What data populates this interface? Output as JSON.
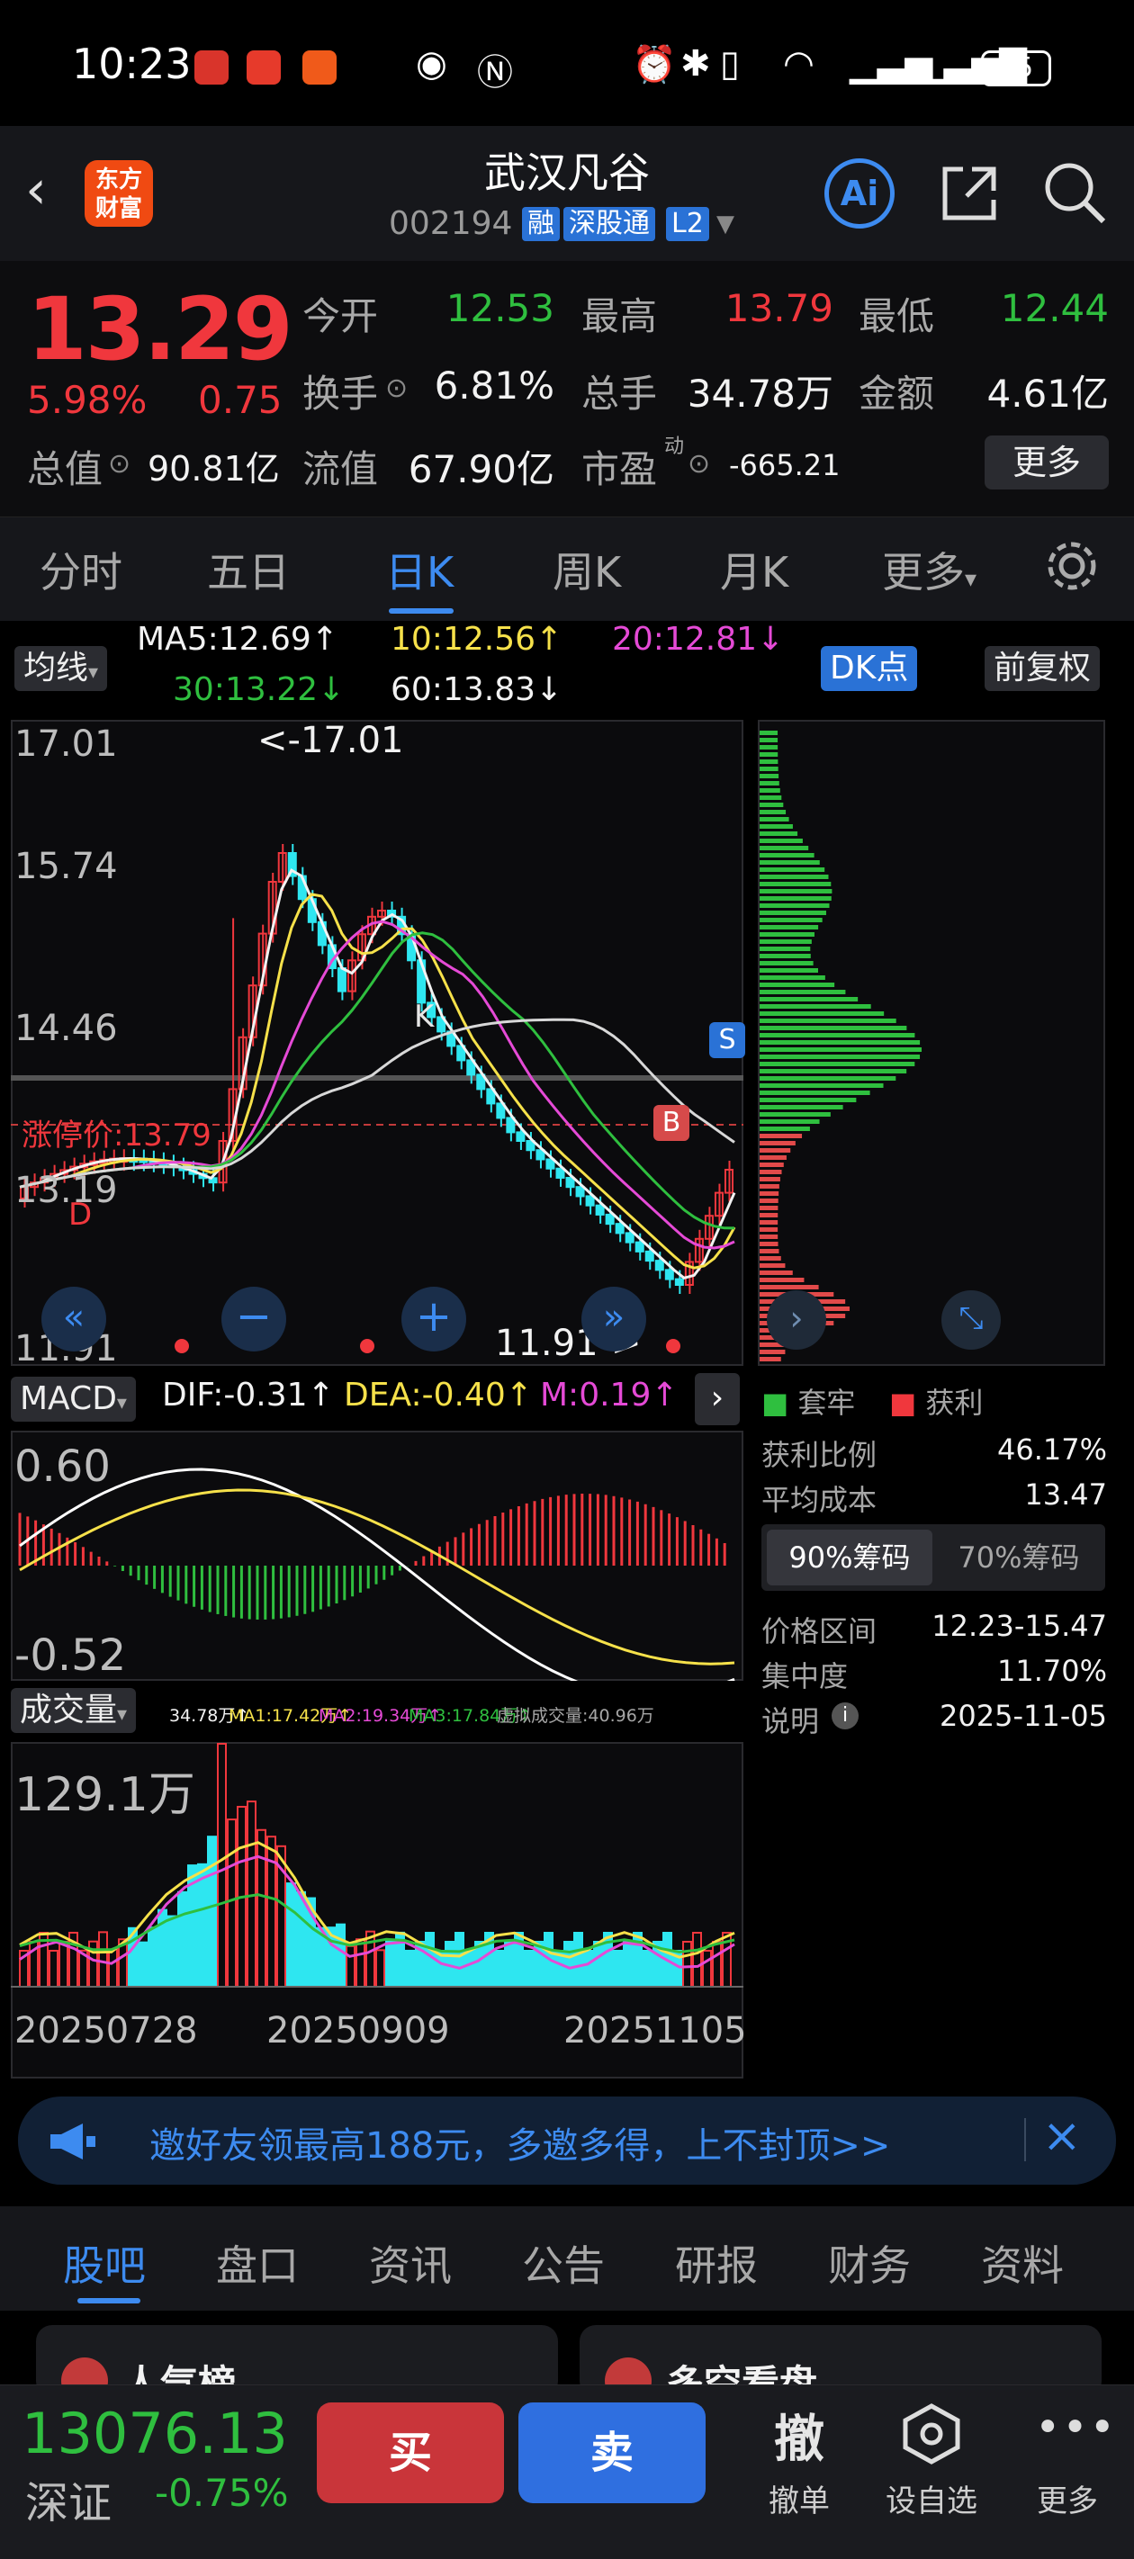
{
  "status_bar": {
    "time": "10:23",
    "battery": "75"
  },
  "header": {
    "stock_name": "武汉凡谷",
    "stock_code": "002194",
    "tags": [
      "融",
      "深股通",
      "L2"
    ],
    "logo_text": [
      "东方",
      "财富"
    ],
    "ai_label": "Ai"
  },
  "quote": {
    "price": "13.29",
    "change_pct": "5.98%",
    "change": "0.75",
    "fields": [
      {
        "label": "今开",
        "value": "12.53",
        "color": "green"
      },
      {
        "label": "最高",
        "value": "13.79",
        "color": "red"
      },
      {
        "label": "最低",
        "value": "12.44",
        "color": "green"
      },
      {
        "label": "换手",
        "value": "6.81%",
        "color": "white"
      },
      {
        "label": "总手",
        "value": "34.78万",
        "color": "white"
      },
      {
        "label": "金额",
        "value": "4.61亿",
        "color": "white"
      },
      {
        "label": "总值",
        "value": "90.81亿",
        "color": "white"
      },
      {
        "label": "流值",
        "value": "67.90亿",
        "color": "white"
      },
      {
        "label": "市盈",
        "value": "-665.21",
        "color": "white"
      }
    ],
    "pe_superscript": "动",
    "more_label": "更多"
  },
  "period_tabs": [
    "分时",
    "五日",
    "日K",
    "周K",
    "月K",
    "更多"
  ],
  "kline": {
    "indicator_label": "均线",
    "ma": [
      {
        "label": "MA5:12.69↑",
        "color": "#f2f2f2"
      },
      {
        "label": "10:12.56↑",
        "color": "#f6e14a"
      },
      {
        "label": "20:12.81↓",
        "color": "#e54ad6"
      },
      {
        "label": "30:13.22↓",
        "color": "#2fbf3f"
      },
      {
        "label": "60:13.83↓",
        "color": "#f2f2f2"
      }
    ],
    "dk_label": "DK点",
    "adjust_label": "前复权",
    "y_labels": [
      "17.01",
      "15.74",
      "14.46",
      "13.19",
      "11.91"
    ],
    "high_mark": "<-17.01",
    "low_mark": "11.91->",
    "limit_label": "涨停价:13.79",
    "b_marker": "B",
    "s_marker": "S",
    "k_marker": "K",
    "d_marker": "D"
  },
  "chips": {
    "legend_hold": "套牢",
    "legend_profit": "获利",
    "profit_ratio_label": "获利比例",
    "profit_ratio": "46.17%",
    "avg_cost_label": "平均成本",
    "avg_cost": "13.47",
    "tab_90": "90%筹码",
    "tab_70": "70%筹码",
    "price_range_label": "价格区间",
    "price_range": "12.23-15.47",
    "concentration_label": "集中度",
    "concentration": "11.70%",
    "note_label": "说明",
    "date": "2025-11-05"
  },
  "macd": {
    "label": "MACD",
    "dif": "DIF:-0.31↑",
    "dea": "DEA:-0.40↑",
    "m": "M:0.19↑",
    "y_top": "0.60",
    "y_bottom": "-0.52"
  },
  "volume": {
    "label": "成交量",
    "v": "34.78万↑",
    "ma1": "MA1:17.42万↑",
    "ma2": "MA2:19.34万↑",
    "ma3": "MA3:17.84万↑",
    "virtual": "虚拟成交量:40.96万",
    "y_top": "129.1万",
    "dates": [
      "20250728",
      "20250909",
      "20251105"
    ]
  },
  "banner": {
    "text": "邀好友领最高188元，多邀多得，上不封顶>>"
  },
  "bottom_tabs": [
    "股吧",
    "盘口",
    "资讯",
    "公告",
    "研报",
    "财务",
    "资料"
  ],
  "cards": [
    "人气榜",
    "多空看盘"
  ],
  "action_bar": {
    "index_value": "13076.13",
    "index_name": "深证",
    "index_change": "-0.75%",
    "buy": "买",
    "sell": "卖",
    "cancel_icon": "撤",
    "cancel": "撤单",
    "watchlist": "设自选",
    "more": "更多"
  }
}
